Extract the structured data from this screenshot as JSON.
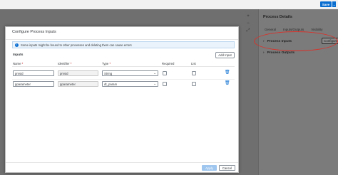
{
  "toolbar": {
    "save_label": "Save",
    "save_menu_icon": "chevron-down-icon"
  },
  "right_panel": {
    "title": "Process Details",
    "tabs": [
      "General",
      "Inputs/Outputs",
      "Visibility"
    ],
    "sections": [
      {
        "label": "Process Inputs",
        "action": "Configure"
      },
      {
        "label": "Process Outputs"
      }
    ]
  },
  "dialog": {
    "title": "Configure Process Inputs",
    "banner": "Some inputs might be bound to other processes and deleting them can cause errors",
    "inputs_label": "Inputs",
    "add_input_label": "Add Input",
    "columns": {
      "name": "Name",
      "identifier": "Identifier",
      "type": "Type",
      "required": "Required",
      "list": "List"
    },
    "required_mark": "*",
    "rows": [
      {
        "name": "pmsid",
        "identifier": "pmsid",
        "type": "String"
      },
      {
        "name": "pparameter",
        "identifier": "pparameter",
        "type": "dt_param"
      }
    ],
    "apply_label": "Apply",
    "cancel_label": "Cancel"
  },
  "colors": {
    "accent": "#0a6ed1",
    "highlight_ring": "#d8322b"
  }
}
